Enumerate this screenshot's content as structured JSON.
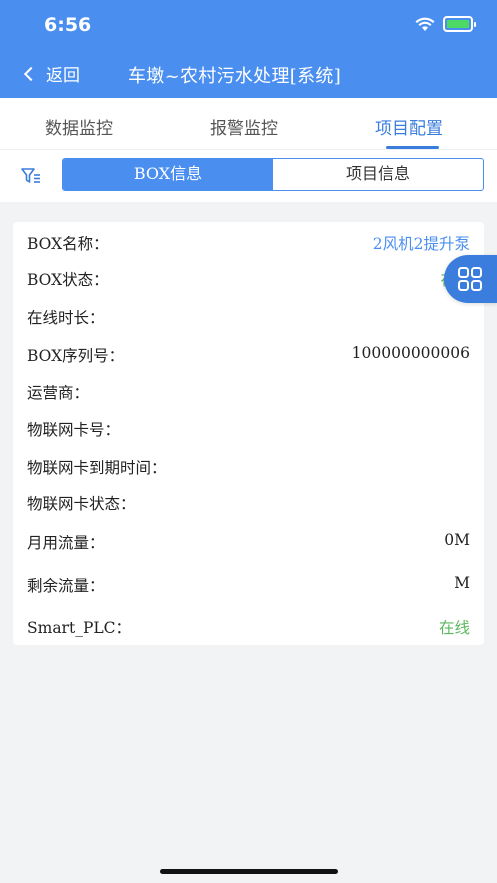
{
  "status_bar": {
    "time": "6:56"
  },
  "nav": {
    "back_label": "返回",
    "title": "车墩~农村污水处理[系统]"
  },
  "tabs": [
    {
      "label": "数据监控"
    },
    {
      "label": "报警监控"
    },
    {
      "label": "项目配置"
    }
  ],
  "segment": [
    {
      "label": "BOX信息"
    },
    {
      "label": "项目信息"
    }
  ],
  "box_info": {
    "rows": [
      {
        "label": "BOX名称：",
        "value": "2风机2提升泵"
      },
      {
        "label": "BOX状态：",
        "value": "在"
      },
      {
        "label": "在线时长：",
        "value": ""
      },
      {
        "label": "BOX序列号：",
        "value": "100000000006"
      },
      {
        "label": "运营商：",
        "value": ""
      },
      {
        "label": "物联网卡号：",
        "value": ""
      },
      {
        "label": "物联网卡到期时间：",
        "value": ""
      },
      {
        "label": "物联网卡状态：",
        "value": ""
      },
      {
        "label": "月用流量：",
        "value": "0M"
      },
      {
        "label": "剩余流量：",
        "value": "M"
      },
      {
        "label": "Smart_PLC：",
        "value": "在线"
      }
    ]
  },
  "colors": {
    "primary": "#4a8ff0",
    "active_tab": "#3b7ddd",
    "online_green": "#5cb85c",
    "background": "#f2f3f5"
  },
  "icons": {
    "back": "chevron-left-icon",
    "filter": "filter-icon",
    "float_menu": "grid-icon",
    "wifi": "wifi-icon",
    "battery": "battery-charging-icon"
  }
}
